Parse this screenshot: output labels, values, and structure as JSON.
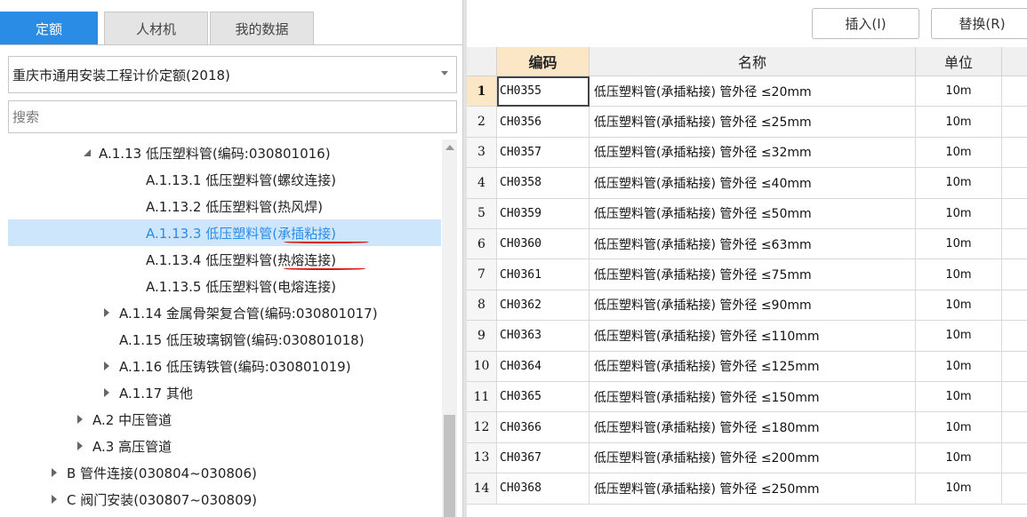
{
  "tabs": [
    {
      "label": "定额",
      "active": true
    },
    {
      "label": "人材机",
      "active": false
    },
    {
      "label": "我的数据",
      "active": false
    }
  ],
  "toolbar": {
    "insert_label": "插入(I)",
    "replace_label": "替换(R)"
  },
  "library_select": {
    "value": "重庆市通用安装工程计价定额(2018)"
  },
  "search": {
    "placeholder": "搜索"
  },
  "tree": [
    {
      "label": "A.1.13 低压塑料管(编码:030801016)",
      "indent": 102,
      "arrow": "down",
      "selected": false
    },
    {
      "label": "A.1.13.1 低压塑料管(螺纹连接)",
      "indent": 155,
      "arrow": "",
      "selected": false
    },
    {
      "label": "A.1.13.2 低压塑料管(热风焊)",
      "indent": 155,
      "arrow": "",
      "selected": false
    },
    {
      "label": "A.1.13.3 低压塑料管(承插粘接)",
      "indent": 155,
      "arrow": "",
      "selected": true
    },
    {
      "label": "A.1.13.4 低压塑料管(热熔连接)",
      "indent": 155,
      "arrow": "",
      "selected": false
    },
    {
      "label": "A.1.13.5 低压塑料管(电熔连接)",
      "indent": 155,
      "arrow": "",
      "selected": false
    },
    {
      "label": "A.1.14 金属骨架复合管(编码:030801017)",
      "indent": 125,
      "arrow": "right",
      "selected": false
    },
    {
      "label": "A.1.15 低压玻璃钢管(编码:030801018)",
      "indent": 125,
      "arrow": "",
      "selected": false
    },
    {
      "label": "A.1.16 低压铸铁管(编码:030801019)",
      "indent": 125,
      "arrow": "right",
      "selected": false
    },
    {
      "label": "A.1.17 其他",
      "indent": 125,
      "arrow": "right",
      "selected": false
    },
    {
      "label": "A.2 中压管道",
      "indent": 95,
      "arrow": "right",
      "selected": false
    },
    {
      "label": "A.3 高压管道",
      "indent": 95,
      "arrow": "right",
      "selected": false
    },
    {
      "label": "B 管件连接(030804~030806)",
      "indent": 66,
      "arrow": "right",
      "selected": false
    },
    {
      "label": "C 阀门安装(030807~030809)",
      "indent": 66,
      "arrow": "right",
      "selected": false
    }
  ],
  "grid": {
    "headers": {
      "code": "编码",
      "name": "名称",
      "unit": "单位"
    },
    "rows": [
      {
        "no": "1",
        "code": "CH0355",
        "name": "低压塑料管(承插粘接) 管外径 ≤20mm",
        "unit": "10m"
      },
      {
        "no": "2",
        "code": "CH0356",
        "name": "低压塑料管(承插粘接) 管外径 ≤25mm",
        "unit": "10m"
      },
      {
        "no": "3",
        "code": "CH0357",
        "name": "低压塑料管(承插粘接) 管外径 ≤32mm",
        "unit": "10m"
      },
      {
        "no": "4",
        "code": "CH0358",
        "name": "低压塑料管(承插粘接) 管外径 ≤40mm",
        "unit": "10m"
      },
      {
        "no": "5",
        "code": "CH0359",
        "name": "低压塑料管(承插粘接) 管外径 ≤50mm",
        "unit": "10m"
      },
      {
        "no": "6",
        "code": "CH0360",
        "name": "低压塑料管(承插粘接) 管外径 ≤63mm",
        "unit": "10m"
      },
      {
        "no": "7",
        "code": "CH0361",
        "name": "低压塑料管(承插粘接) 管外径 ≤75mm",
        "unit": "10m"
      },
      {
        "no": "8",
        "code": "CH0362",
        "name": "低压塑料管(承插粘接) 管外径 ≤90mm",
        "unit": "10m"
      },
      {
        "no": "9",
        "code": "CH0363",
        "name": "低压塑料管(承插粘接) 管外径 ≤110mm",
        "unit": "10m"
      },
      {
        "no": "10",
        "code": "CH0364",
        "name": "低压塑料管(承插粘接) 管外径 ≤125mm",
        "unit": "10m"
      },
      {
        "no": "11",
        "code": "CH0365",
        "name": "低压塑料管(承插粘接) 管外径 ≤150mm",
        "unit": "10m"
      },
      {
        "no": "12",
        "code": "CH0366",
        "name": "低压塑料管(承插粘接) 管外径 ≤180mm",
        "unit": "10m"
      },
      {
        "no": "13",
        "code": "CH0367",
        "name": "低压塑料管(承插粘接) 管外径 ≤200mm",
        "unit": "10m"
      },
      {
        "no": "14",
        "code": "CH0368",
        "name": "低压塑料管(承插粘接) 管外径 ≤250mm",
        "unit": "10m"
      }
    ]
  },
  "colors": {
    "accent": "#2b8ce6",
    "selected_row": "#cde6fb",
    "code_header": "#fbe7c6",
    "annotation_red": "#d11111"
  }
}
